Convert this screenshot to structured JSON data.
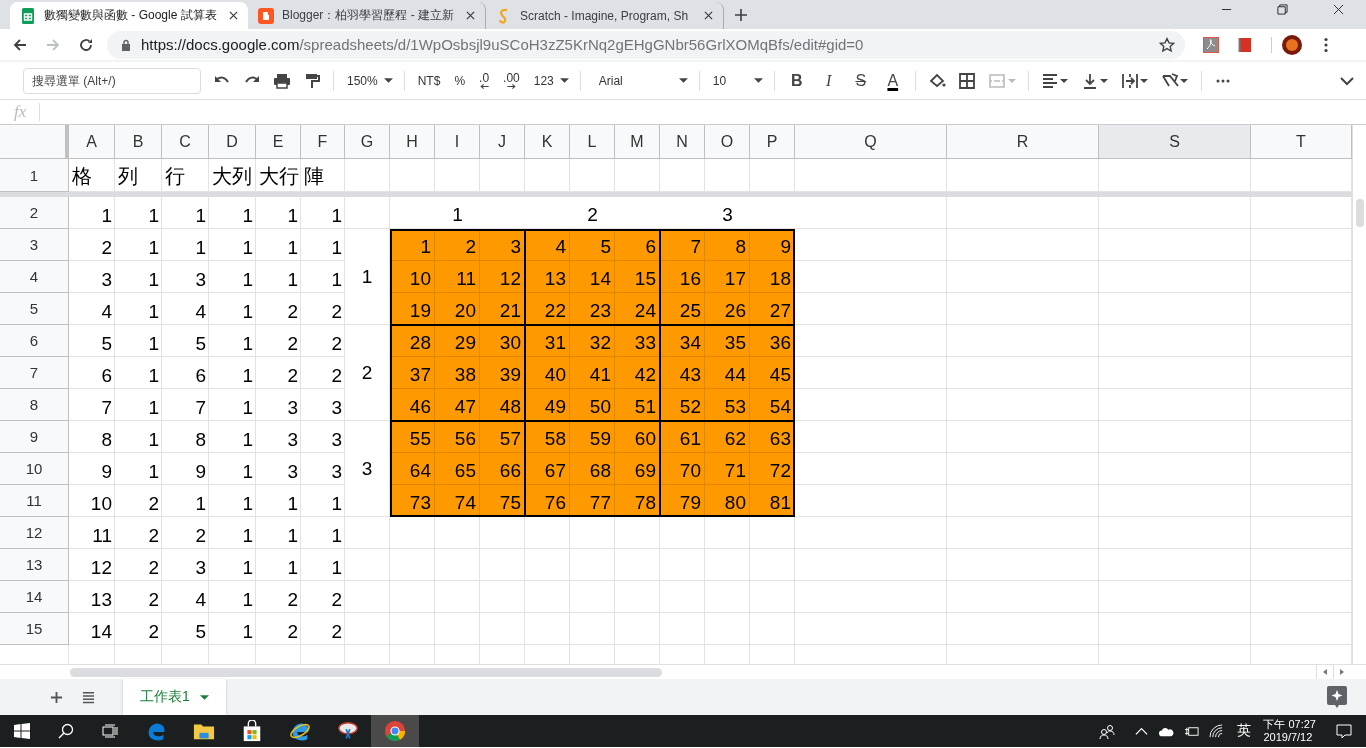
{
  "browser": {
    "tabs": [
      {
        "title": "數獨變數與函數 - Google 試算表",
        "kind": "sheets",
        "selected": true
      },
      {
        "title": "Blogger：柏羽學習歷程 - 建立新",
        "kind": "blogger",
        "selected": false
      },
      {
        "title": "Scratch - Imagine, Program, Sh",
        "kind": "scratch",
        "selected": false
      }
    ],
    "url_host": "https://docs.google.com",
    "url_path": "/spreadsheets/d/1WpOsbsjl9uSCoH3zZ5KrNq2gEHgGNbr56GrlXOMqBfs/edit#gid=0"
  },
  "toolbar": {
    "menu_search": {
      "placeholder": "搜尋選單 (Alt+/)"
    },
    "zoom": "150%",
    "currency": "NT$",
    "percent": "%",
    "decimal_decrease": ".0",
    "decimal_increase": ".00",
    "number_format": "123",
    "font": "Arial",
    "font_size": "10",
    "format_buttons": [
      {
        "kind": "bold",
        "label": "B"
      },
      {
        "kind": "italic",
        "label": "I"
      },
      {
        "kind": "strike",
        "label": "S"
      },
      {
        "kind": "color",
        "label": "A"
      }
    ]
  },
  "formula_bar": {
    "label": "fx"
  },
  "sheet": {
    "columns": [
      {
        "label": "A",
        "selected": false
      },
      {
        "label": "B",
        "selected": false
      },
      {
        "label": "C",
        "selected": false
      },
      {
        "label": "D",
        "selected": false
      },
      {
        "label": "E",
        "selected": false
      },
      {
        "label": "F",
        "selected": false
      },
      {
        "label": "G",
        "selected": false
      },
      {
        "label": "H",
        "selected": false
      },
      {
        "label": "I",
        "selected": false
      },
      {
        "label": "J",
        "selected": false
      },
      {
        "label": "K",
        "selected": false
      },
      {
        "label": "L",
        "selected": false
      },
      {
        "label": "M",
        "selected": false
      },
      {
        "label": "N",
        "selected": false
      },
      {
        "label": "O",
        "selected": false
      },
      {
        "label": "P",
        "selected": false
      },
      {
        "label": "Q",
        "selected": false
      },
      {
        "label": "R",
        "selected": false
      },
      {
        "label": "S",
        "selected": true
      },
      {
        "label": "T",
        "selected": false
      }
    ],
    "rows": [
      {
        "label": "1",
        "values": [
          "格",
          "列",
          "行",
          "大列",
          "大行",
          "陣"
        ]
      },
      {
        "label": "2",
        "values": [
          "1",
          "1",
          "1",
          "1",
          "1",
          "1"
        ]
      },
      {
        "label": "3",
        "values": [
          "2",
          "1",
          "1",
          "1",
          "1",
          "1"
        ]
      },
      {
        "label": "4",
        "values": [
          "3",
          "1",
          "3",
          "1",
          "1",
          "1"
        ]
      },
      {
        "label": "5",
        "values": [
          "4",
          "1",
          "4",
          "1",
          "2",
          "2"
        ]
      },
      {
        "label": "6",
        "values": [
          "5",
          "1",
          "5",
          "1",
          "2",
          "2"
        ]
      },
      {
        "label": "7",
        "values": [
          "6",
          "1",
          "6",
          "1",
          "2",
          "2"
        ]
      },
      {
        "label": "8",
        "values": [
          "7",
          "1",
          "7",
          "1",
          "3",
          "3"
        ]
      },
      {
        "label": "9",
        "values": [
          "8",
          "1",
          "8",
          "1",
          "3",
          "3"
        ]
      },
      {
        "label": "10",
        "values": [
          "9",
          "1",
          "9",
          "1",
          "3",
          "3"
        ]
      },
      {
        "label": "11",
        "values": [
          "10",
          "2",
          "1",
          "1",
          "1",
          "1"
        ]
      },
      {
        "label": "12",
        "values": [
          "11",
          "2",
          "2",
          "1",
          "1",
          "1"
        ]
      },
      {
        "label": "13",
        "values": [
          "12",
          "2",
          "3",
          "1",
          "1",
          "1"
        ]
      },
      {
        "label": "14",
        "values": [
          "13",
          "2",
          "4",
          "1",
          "2",
          "2"
        ]
      },
      {
        "label": "15",
        "values": [
          "14",
          "2",
          "5",
          "1",
          "2",
          "2"
        ]
      }
    ],
    "block_headers": [
      "1",
      "2",
      "3"
    ],
    "side_labels": [
      "1",
      "2",
      "3"
    ],
    "numbers": {
      "rows": [
        [
          "1",
          "2",
          "3",
          "4",
          "5",
          "6",
          "7",
          "8",
          "9"
        ],
        [
          "10",
          "11",
          "12",
          "13",
          "14",
          "15",
          "16",
          "17",
          "18"
        ],
        [
          "19",
          "20",
          "21",
          "22",
          "23",
          "24",
          "25",
          "26",
          "27"
        ],
        [
          "28",
          "29",
          "30",
          "31",
          "32",
          "33",
          "34",
          "35",
          "36"
        ],
        [
          "37",
          "38",
          "39",
          "40",
          "41",
          "42",
          "43",
          "44",
          "45"
        ],
        [
          "46",
          "47",
          "48",
          "49",
          "50",
          "51",
          "52",
          "53",
          "54"
        ],
        [
          "55",
          "56",
          "57",
          "58",
          "59",
          "60",
          "61",
          "62",
          "63"
        ],
        [
          "64",
          "65",
          "66",
          "67",
          "68",
          "69",
          "70",
          "71",
          "72"
        ],
        [
          "73",
          "74",
          "75",
          "76",
          "77",
          "78",
          "79",
          "80",
          "81"
        ]
      ]
    }
  },
  "sheet_tabs": [
    {
      "label": "工作表1",
      "selected": true
    }
  ],
  "taskbar": {
    "ime": "英",
    "time": "下午 07:27",
    "date": "2019/7/12"
  }
}
